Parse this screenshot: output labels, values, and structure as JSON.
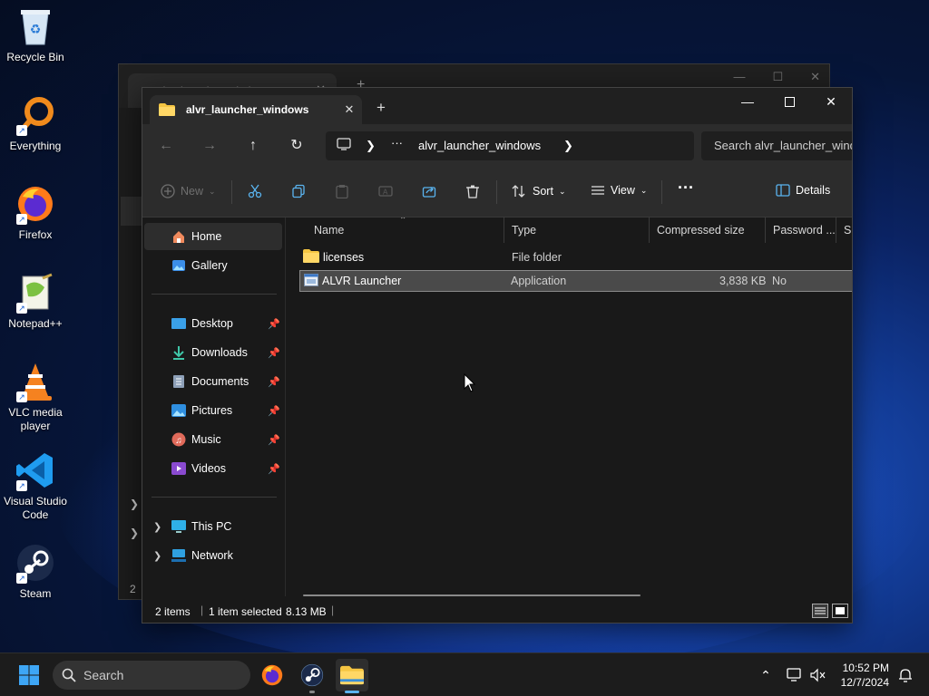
{
  "desktop": {
    "icons": [
      {
        "label": "Recycle Bin"
      },
      {
        "label": "Everything"
      },
      {
        "label": "Firefox"
      },
      {
        "label": "Notepad++"
      },
      {
        "label": "VLC media player"
      },
      {
        "label": "Visual Studio Code"
      },
      {
        "label": "Steam"
      }
    ]
  },
  "background_window": {
    "tab_title": "alvr_launcher_windows",
    "status_fragment": "2"
  },
  "window": {
    "tab_title": "alvr_launcher_windows",
    "address": {
      "path_segment": "alvr_launcher_windows",
      "overflow": "···"
    },
    "search_placeholder": "Search alvr_launcher_windows",
    "commands": {
      "new": "New",
      "sort": "Sort",
      "view": "View",
      "more": "···",
      "details": "Details"
    },
    "sidebar": {
      "home": "Home",
      "gallery": "Gallery",
      "quick_access": [
        {
          "label": "Desktop"
        },
        {
          "label": "Downloads"
        },
        {
          "label": "Documents"
        },
        {
          "label": "Pictures"
        },
        {
          "label": "Music"
        },
        {
          "label": "Videos"
        }
      ],
      "this_pc": "This PC",
      "network": "Network"
    },
    "columns": {
      "name": "Name",
      "type": "Type",
      "compressed_size": "Compressed size",
      "password": "Password ...",
      "size": "Si"
    },
    "files": [
      {
        "name": "licenses",
        "type": "File folder",
        "compressed_size": "",
        "password": "",
        "selected": false
      },
      {
        "name": "ALVR Launcher",
        "type": "Application",
        "compressed_size": "3,838 KB",
        "password": "No",
        "selected": true
      }
    ],
    "status": {
      "items": "2 items",
      "selected": "1 item selected",
      "size": "8.13 MB"
    }
  },
  "taskbar": {
    "search_label": "Search",
    "time": "10:52 PM",
    "date": "12/7/2024"
  },
  "colors": {
    "accent": "#5ab4f0",
    "folder": "#f5c542",
    "window_bg": "#191919",
    "bar_bg": "#2c2c2c"
  }
}
